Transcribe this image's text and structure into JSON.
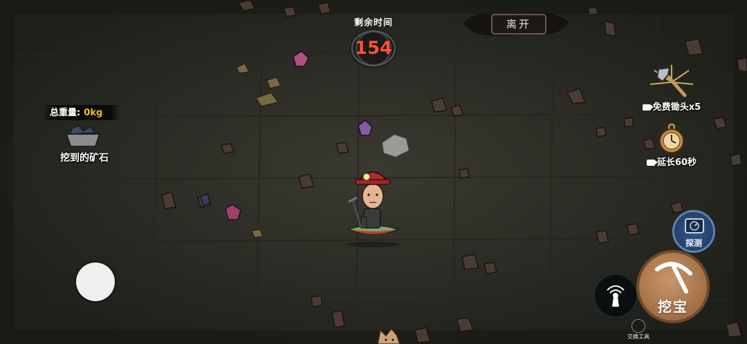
{
  "hud": {
    "timer": {
      "label": "剩余时间",
      "value": "154"
    },
    "leave_label": "离开",
    "weight": {
      "label": "总重量:",
      "value": "0kg"
    },
    "ore_label": "挖到的矿石",
    "free_hoe_label": "免费锄头x5",
    "extend_label": "延长60秒",
    "detect_label": "探测",
    "dig_label": "挖宝",
    "swap_tool_label": "交换工具"
  },
  "colors": {
    "ground": "#2b2a24",
    "timer_digits": "#ff5233",
    "weight_value": "#f4b83c",
    "dig_button": "#a8744a",
    "detect_button": "#2b4a78"
  },
  "icons": [
    "ore-cart-icon",
    "pickaxe-icon",
    "hoe-icon",
    "pocket-watch-icon",
    "radar-icon",
    "beacon-icon",
    "swap-icon",
    "video-icon"
  ]
}
